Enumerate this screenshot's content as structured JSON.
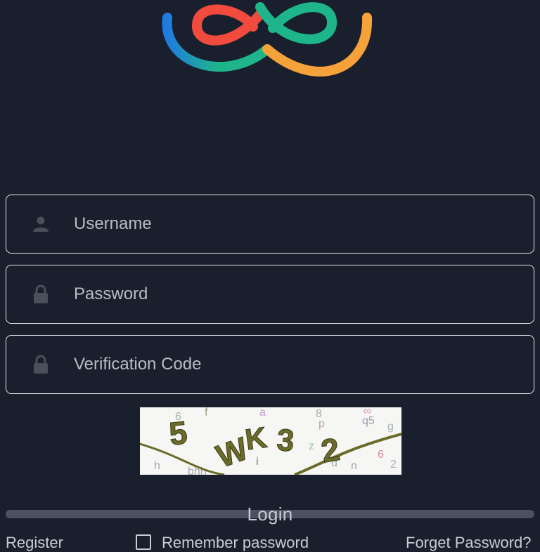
{
  "brand": {
    "logo_icon": "infinity-logo-icon",
    "colors": {
      "blue": "#2196f3",
      "red": "#f04b3c",
      "green": "#1fb58b",
      "orange": "#f5a23a"
    }
  },
  "form": {
    "username": {
      "placeholder": "Username",
      "icon": "user-icon"
    },
    "password": {
      "placeholder": "Password",
      "icon": "lock-icon"
    },
    "verification": {
      "placeholder": "Verification Code",
      "icon": "lock-icon"
    },
    "captcha_image": "captcha-image",
    "login_label": "Login",
    "register_label": "Register",
    "remember_label": "Remember password",
    "forgot_label": "Forget Password?"
  },
  "theme": {
    "background": "#1a1f2e",
    "field_border": "#e6e8ee",
    "login_bar": "#4b5161"
  }
}
